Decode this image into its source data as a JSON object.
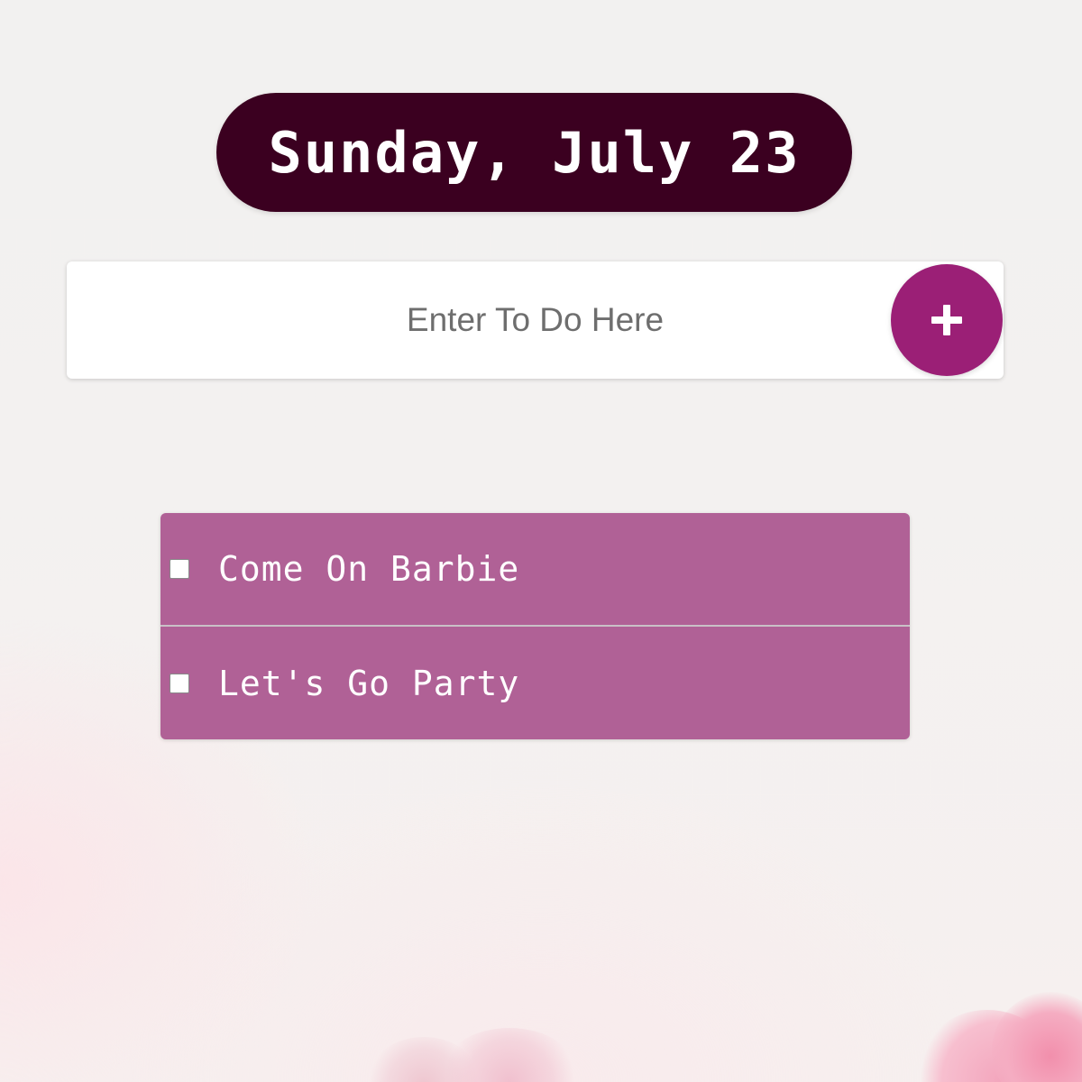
{
  "date_display": "Sunday, July 23",
  "todo_input": {
    "value": "",
    "placeholder": "Enter To Do Here"
  },
  "add_button": {
    "icon": "plus-icon"
  },
  "todos": [
    {
      "text": "Come On Barbie",
      "checked": false
    },
    {
      "text": "Let's Go Party",
      "checked": false
    }
  ],
  "colors": {
    "date_pill_bg": "#3b0020",
    "add_button_bg": "#9b1f76",
    "list_bg": "#b06196"
  }
}
